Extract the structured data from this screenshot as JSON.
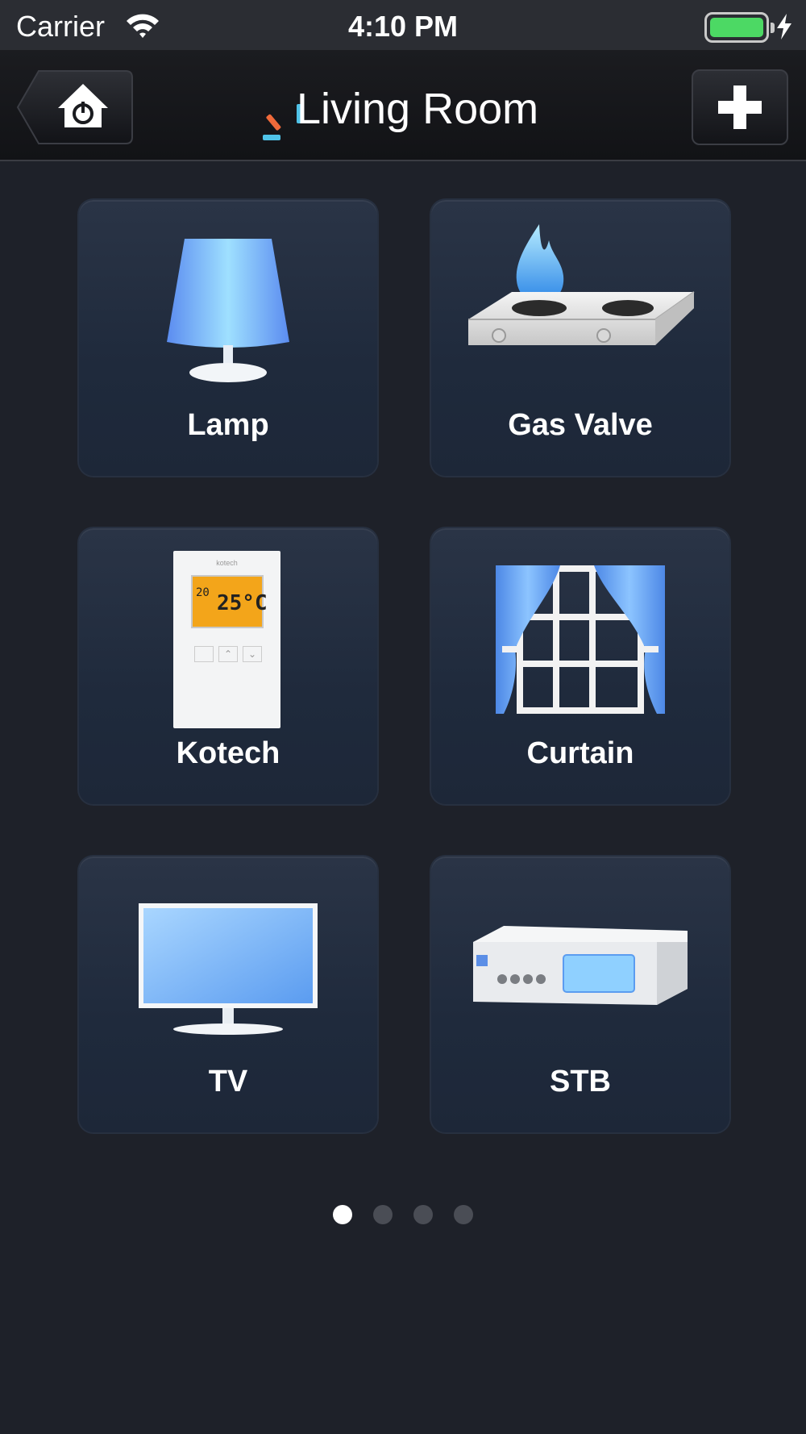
{
  "status_bar": {
    "carrier": "Carrier",
    "time": "4:10 PM",
    "icons": [
      "wifi-icon",
      "battery-icon",
      "charging-bolt-icon"
    ],
    "battery_color": "#4cd964",
    "battery_level": 1.0
  },
  "nav_bar": {
    "title": "Living Room",
    "back_icon": "home-power-icon",
    "add_icon": "plus-icon",
    "logo_icon": "brand-logo-icon"
  },
  "devices": [
    {
      "label": "Lamp",
      "icon": "lamp-icon"
    },
    {
      "label": "Gas Valve",
      "icon": "gas-stove-icon"
    },
    {
      "label": "Kotech",
      "icon": "thermostat-icon",
      "display_temp": "25°C",
      "display_small": "20",
      "brand_text": "kotech"
    },
    {
      "label": "Curtain",
      "icon": "curtain-icon"
    },
    {
      "label": "TV",
      "icon": "tv-icon"
    },
    {
      "label": "STB",
      "icon": "set-top-box-icon"
    }
  ],
  "pagination": {
    "total": 4,
    "current": 1
  },
  "colors": {
    "background": "#1e2129",
    "tile": "#1f2a3c",
    "accent_blue": "#6aaeff",
    "logo_orange": "#f06a3a",
    "logo_cyan": "#4fc3e8"
  }
}
